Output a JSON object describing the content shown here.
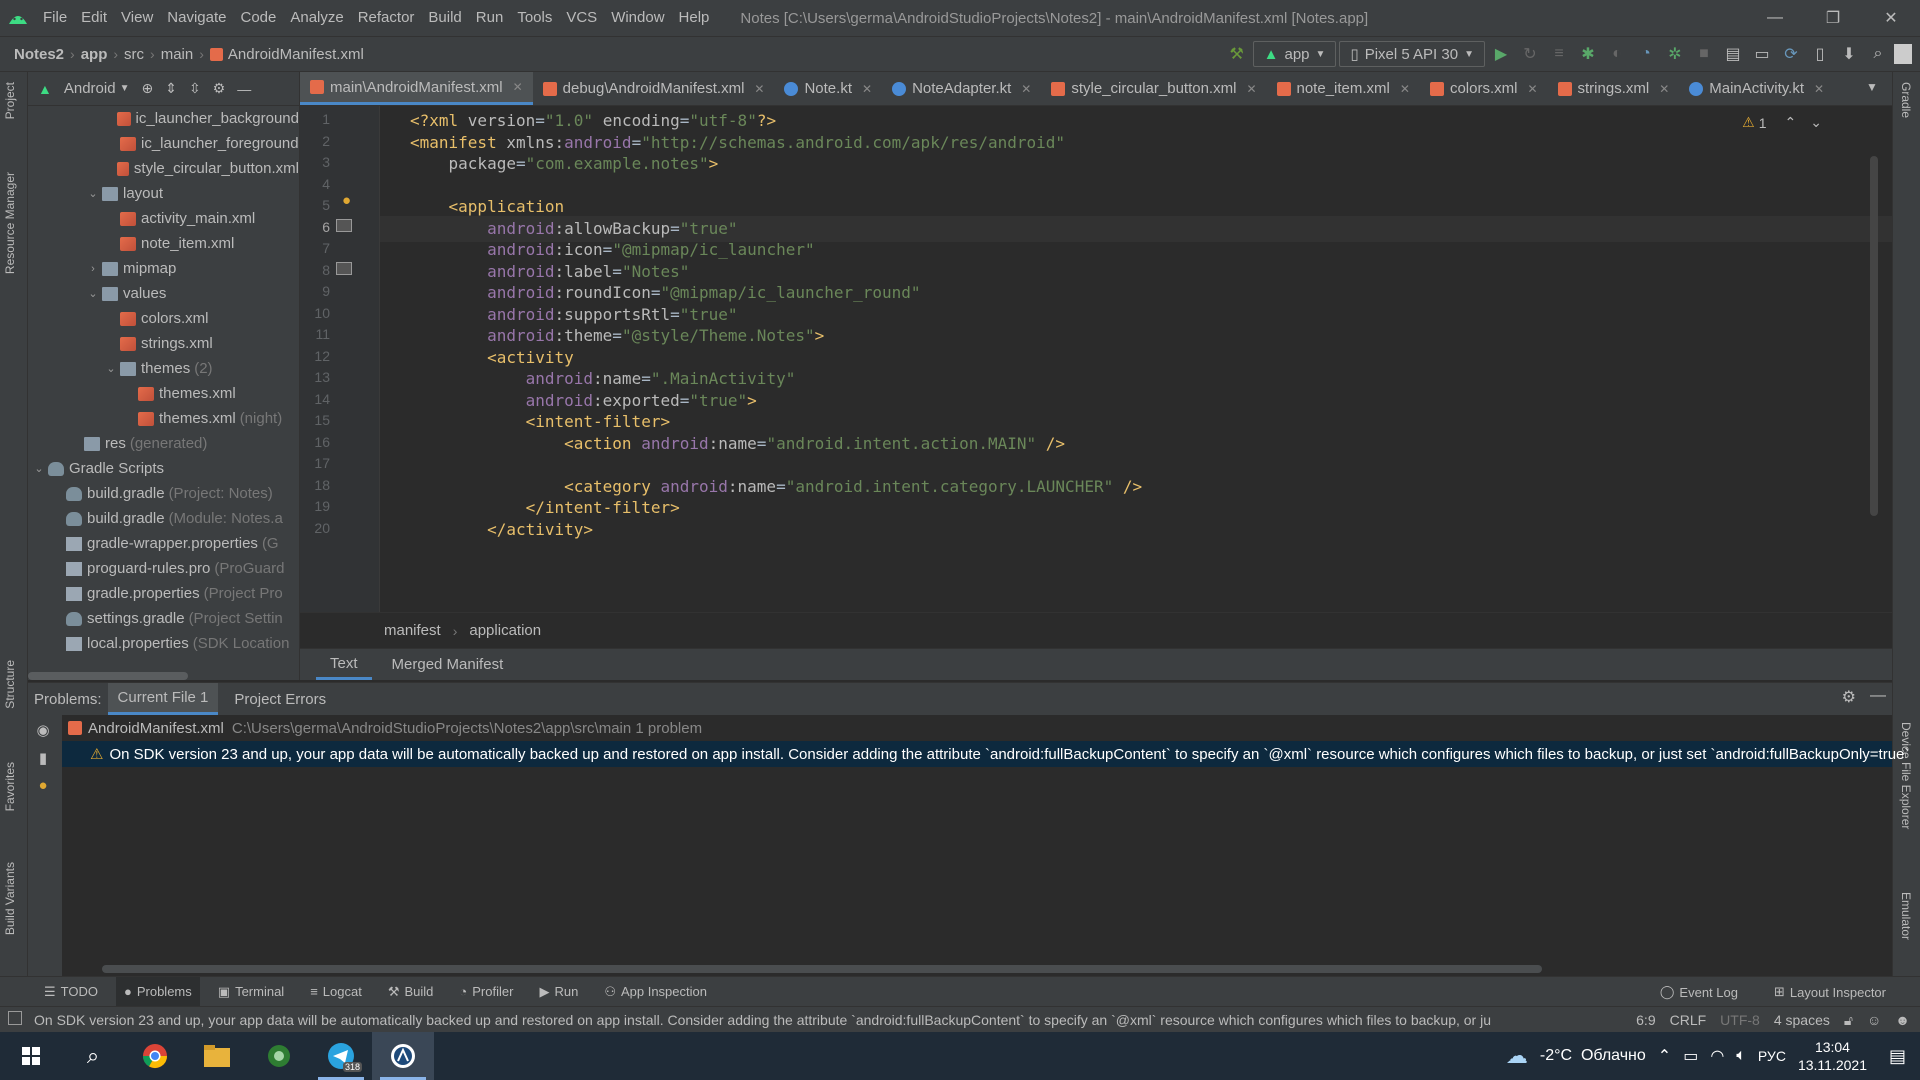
{
  "menu": {
    "items": [
      "File",
      "Edit",
      "View",
      "Navigate",
      "Code",
      "Analyze",
      "Refactor",
      "Build",
      "Run",
      "Tools",
      "VCS",
      "Window",
      "Help"
    ],
    "window_title": "Notes [C:\\Users\\germa\\AndroidStudioProjects\\Notes2] - main\\AndroidManifest.xml [Notes.app]"
  },
  "nav": {
    "crumbs": [
      "Notes2",
      "app",
      "src",
      "main",
      "AndroidManifest.xml"
    ],
    "run_config": "app",
    "device": "Pixel 5 API 30"
  },
  "left_strip": {
    "tabs": [
      "Project",
      "Resource Manager",
      "Structure",
      "Favorites",
      "Build Variants"
    ]
  },
  "right_strip": {
    "tabs": [
      "Gradle",
      "Device File Explorer",
      "Emulator"
    ]
  },
  "project": {
    "title": "Android",
    "tree": [
      {
        "label": "ic_launcher_background",
        "hint": "",
        "indent": 4,
        "icon": "xml",
        "arrow": ""
      },
      {
        "label": "ic_launcher_foreground",
        "hint": "",
        "indent": 4,
        "icon": "xml",
        "arrow": ""
      },
      {
        "label": "style_circular_button.xml",
        "hint": "",
        "indent": 4,
        "icon": "xml",
        "arrow": ""
      },
      {
        "label": "layout",
        "hint": "",
        "indent": 3,
        "icon": "folder",
        "arrow": "v"
      },
      {
        "label": "activity_main.xml",
        "hint": "",
        "indent": 4,
        "icon": "xml",
        "arrow": ""
      },
      {
        "label": "note_item.xml",
        "hint": "",
        "indent": 4,
        "icon": "xml",
        "arrow": ""
      },
      {
        "label": "mipmap",
        "hint": "",
        "indent": 3,
        "icon": "folder",
        "arrow": ">"
      },
      {
        "label": "values",
        "hint": "",
        "indent": 3,
        "icon": "folder",
        "arrow": "v"
      },
      {
        "label": "colors.xml",
        "hint": "",
        "indent": 4,
        "icon": "xml",
        "arrow": ""
      },
      {
        "label": "strings.xml",
        "hint": "",
        "indent": 4,
        "icon": "xml",
        "arrow": ""
      },
      {
        "label": "themes",
        "hint": "(2)",
        "indent": 4,
        "icon": "folder",
        "arrow": "v"
      },
      {
        "label": "themes.xml",
        "hint": "",
        "indent": 5,
        "icon": "xml",
        "arrow": ""
      },
      {
        "label": "themes.xml",
        "hint": "(night)",
        "indent": 5,
        "icon": "xml",
        "arrow": ""
      },
      {
        "label": "res",
        "hint": "(generated)",
        "indent": 2,
        "icon": "folder",
        "arrow": ""
      },
      {
        "label": "Gradle Scripts",
        "hint": "",
        "indent": 0,
        "icon": "gradle",
        "arrow": "v"
      },
      {
        "label": "build.gradle",
        "hint": "(Project: Notes)",
        "indent": 1,
        "icon": "gradle",
        "arrow": ""
      },
      {
        "label": "build.gradle",
        "hint": "(Module: Notes.a",
        "indent": 1,
        "icon": "gradle",
        "arrow": ""
      },
      {
        "label": "gradle-wrapper.properties",
        "hint": "(G",
        "indent": 1,
        "icon": "file",
        "arrow": ""
      },
      {
        "label": "proguard-rules.pro",
        "hint": "(ProGuard",
        "indent": 1,
        "icon": "file",
        "arrow": ""
      },
      {
        "label": "gradle.properties",
        "hint": "(Project Pro",
        "indent": 1,
        "icon": "file",
        "arrow": ""
      },
      {
        "label": "settings.gradle",
        "hint": "(Project Settin",
        "indent": 1,
        "icon": "gradle",
        "arrow": ""
      },
      {
        "label": "local.properties",
        "hint": "(SDK Location",
        "indent": 1,
        "icon": "file",
        "arrow": ""
      }
    ]
  },
  "editor_tabs": [
    {
      "label": "main\\AndroidManifest.xml",
      "kind": "xml",
      "active": true
    },
    {
      "label": "debug\\AndroidManifest.xml",
      "kind": "xml",
      "active": false
    },
    {
      "label": "Note.kt",
      "kind": "kt",
      "active": false
    },
    {
      "label": "NoteAdapter.kt",
      "kind": "kt",
      "active": false
    },
    {
      "label": "style_circular_button.xml",
      "kind": "xml",
      "active": false
    },
    {
      "label": "note_item.xml",
      "kind": "xml",
      "active": false
    },
    {
      "label": "colors.xml",
      "kind": "xml",
      "active": false
    },
    {
      "label": "strings.xml",
      "kind": "xml",
      "active": false
    },
    {
      "label": "MainActivity.kt",
      "kind": "kt",
      "active": false
    }
  ],
  "editor": {
    "warning_count": "1",
    "current_line": 6,
    "lines": [
      [
        [
          "pi",
          "<?xml "
        ],
        [
          "attr",
          "version"
        ],
        [
          "plain",
          "="
        ],
        [
          "val",
          "\"1.0\""
        ],
        [
          "plain",
          " "
        ],
        [
          "attr",
          "encoding"
        ],
        [
          "plain",
          "="
        ],
        [
          "val",
          "\"utf-8\""
        ],
        [
          "pi",
          "?>"
        ]
      ],
      [
        [
          "tag",
          "<manifest "
        ],
        [
          "attr",
          "xmlns:"
        ],
        [
          "ns",
          "android"
        ],
        [
          "plain",
          "="
        ],
        [
          "val",
          "\"http://schemas.android.com/apk/res/android\""
        ]
      ],
      [
        [
          "plain",
          "    "
        ],
        [
          "attr",
          "package"
        ],
        [
          "plain",
          "="
        ],
        [
          "val",
          "\"com.example.notes\""
        ],
        [
          "tag",
          ">"
        ]
      ],
      [],
      [
        [
          "plain",
          "    "
        ],
        [
          "tag",
          "<application"
        ]
      ],
      [
        [
          "plain",
          "        "
        ],
        [
          "ns",
          "android"
        ],
        [
          "attr",
          ":allowBackup"
        ],
        [
          "plain",
          "="
        ],
        [
          "val",
          "\"true\""
        ]
      ],
      [
        [
          "plain",
          "        "
        ],
        [
          "ns",
          "android"
        ],
        [
          "attr",
          ":icon"
        ],
        [
          "plain",
          "="
        ],
        [
          "val",
          "\"@mipmap/ic_launcher\""
        ]
      ],
      [
        [
          "plain",
          "        "
        ],
        [
          "ns",
          "android"
        ],
        [
          "attr",
          ":label"
        ],
        [
          "plain",
          "="
        ],
        [
          "val",
          "\"Notes\""
        ]
      ],
      [
        [
          "plain",
          "        "
        ],
        [
          "ns",
          "android"
        ],
        [
          "attr",
          ":roundIcon"
        ],
        [
          "plain",
          "="
        ],
        [
          "val",
          "\"@mipmap/ic_launcher_round\""
        ]
      ],
      [
        [
          "plain",
          "        "
        ],
        [
          "ns",
          "android"
        ],
        [
          "attr",
          ":supportsRtl"
        ],
        [
          "plain",
          "="
        ],
        [
          "val",
          "\"true\""
        ]
      ],
      [
        [
          "plain",
          "        "
        ],
        [
          "ns",
          "android"
        ],
        [
          "attr",
          ":theme"
        ],
        [
          "plain",
          "="
        ],
        [
          "val",
          "\"@style/Theme.Notes\""
        ],
        [
          "tag",
          ">"
        ]
      ],
      [
        [
          "plain",
          "        "
        ],
        [
          "tag",
          "<activity"
        ]
      ],
      [
        [
          "plain",
          "            "
        ],
        [
          "ns",
          "android"
        ],
        [
          "attr",
          ":name"
        ],
        [
          "plain",
          "="
        ],
        [
          "val",
          "\".MainActivity\""
        ]
      ],
      [
        [
          "plain",
          "            "
        ],
        [
          "ns",
          "android"
        ],
        [
          "attr",
          ":exported"
        ],
        [
          "plain",
          "="
        ],
        [
          "val",
          "\"true\""
        ],
        [
          "tag",
          ">"
        ]
      ],
      [
        [
          "plain",
          "            "
        ],
        [
          "tag",
          "<intent-filter>"
        ]
      ],
      [
        [
          "plain",
          "                "
        ],
        [
          "tag",
          "<action "
        ],
        [
          "ns",
          "android"
        ],
        [
          "attr",
          ":name"
        ],
        [
          "plain",
          "="
        ],
        [
          "val",
          "\"android.intent.action.MAIN\""
        ],
        [
          "tag",
          " />"
        ]
      ],
      [],
      [
        [
          "plain",
          "                "
        ],
        [
          "tag",
          "<category "
        ],
        [
          "ns",
          "android"
        ],
        [
          "attr",
          ":name"
        ],
        [
          "plain",
          "="
        ],
        [
          "val",
          "\"android.intent.category.LAUNCHER\""
        ],
        [
          "tag",
          " />"
        ]
      ],
      [
        [
          "plain",
          "            "
        ],
        [
          "tag",
          "</intent-filter>"
        ]
      ],
      [
        [
          "plain",
          "        "
        ],
        [
          "tag",
          "</activity>"
        ]
      ]
    ]
  },
  "breadcrumb_bottom": [
    "manifest",
    "application"
  ],
  "text_tabs": [
    "Text",
    "Merged Manifest"
  ],
  "problems": {
    "label": "Problems:",
    "tabs": [
      "Current File 1",
      "Project Errors"
    ],
    "file": "AndroidManifest.xml",
    "path": "C:\\Users\\germa\\AndroidStudioProjects\\Notes2\\app\\src\\main  1 problem",
    "message": "On SDK version 23 and up, your app data will be automatically backed up and restored on app install. Consider adding the attribute `android:fullBackupContent` to specify an `@xml` resource which configures which files to backup, or just set `android:fullBackupOnly=true`"
  },
  "bottom_tools": [
    "TODO",
    "Problems",
    "Terminal",
    "Logcat",
    "Build",
    "Profiler",
    "Run",
    "App Inspection"
  ],
  "bottom_tools_right": [
    "Event Log",
    "Layout Inspector"
  ],
  "status": {
    "message": "On SDK version 23 and up, your app data will be automatically backed up and restored on app install. Consider adding the attribute `android:fullBackupContent` to specify an `@xml` resource which configures which files to backup, or ju",
    "position": "6:9",
    "line_sep": "CRLF",
    "encoding": "UTF-8",
    "indent": "4 spaces"
  },
  "taskbar": {
    "telegram_badge": "318",
    "weather": "-2°C  Облачно",
    "lang": "РУС",
    "time": "13:04",
    "date": "13.11.2021"
  },
  "colors": {
    "accent": "#4a88c7",
    "warning": "#e0a832",
    "tag": "#e8bf6a",
    "value": "#6a8759",
    "namespace": "#9876aa"
  }
}
